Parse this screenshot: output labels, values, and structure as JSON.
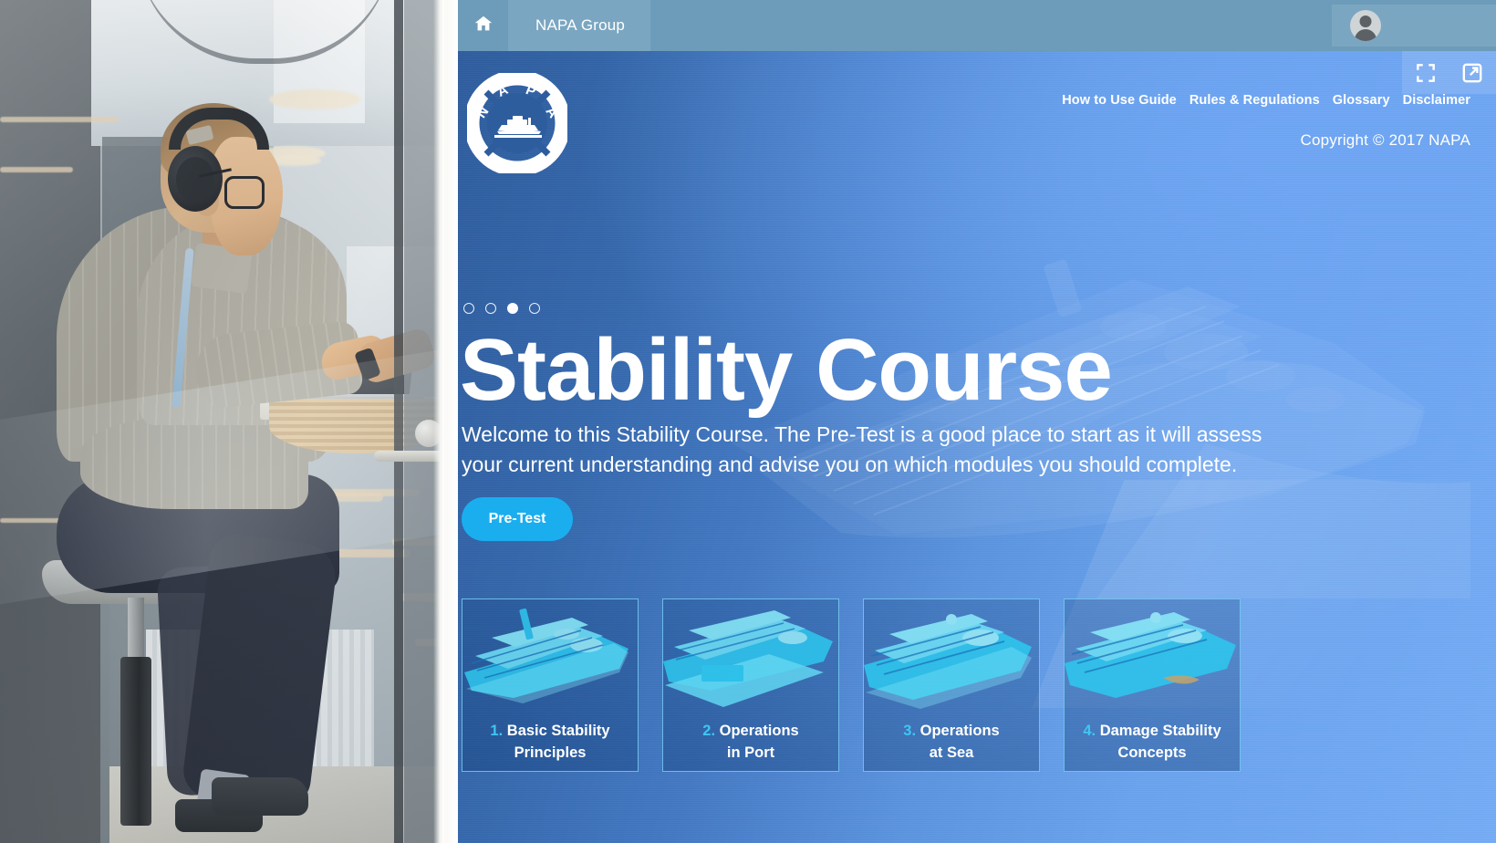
{
  "breadcrumb": {
    "home_icon": "home-icon",
    "items": [
      {
        "label": "NAPA Group"
      }
    ],
    "user": {
      "avatar_icon": "user-avatar-icon"
    }
  },
  "window_controls": {
    "fullscreen_label": "fullscreen-icon",
    "popout_label": "open-in-new-window-icon"
  },
  "brand": {
    "logo_name": "NAPA",
    "logo_letters": "NAPA"
  },
  "top_nav": {
    "links": [
      {
        "label": "How to Use Guide"
      },
      {
        "label": "Rules & Regulations"
      },
      {
        "label": "Glossary"
      },
      {
        "label": "Disclaimer"
      }
    ]
  },
  "copyright": "Copyright © 2017 NAPA",
  "carousel": {
    "total": 4,
    "active_index": 2
  },
  "hero": {
    "title": "Stability Course",
    "description": "Welcome to this Stability Course. The Pre-Test is a good place to start as it will assess your current understanding and advise you on which modules you should complete.",
    "cta_label": "Pre-Test"
  },
  "modules": [
    {
      "number": "1.",
      "line1": "Basic Stability",
      "line2": "Principles"
    },
    {
      "number": "2.",
      "line1": "Operations",
      "line2": "in Port"
    },
    {
      "number": "3.",
      "line1": "Operations",
      "line2": "at Sea"
    },
    {
      "number": "4.",
      "line1": "Damage Stability",
      "line2": "Concepts"
    }
  ],
  "colors": {
    "breadcrumb_bar": "#6d9cba",
    "breadcrumb_active": "#7aa6c1",
    "hero_gradient_start": "#2e5d9e",
    "hero_gradient_end": "#74acf6",
    "accent_cyan": "#1aaeef",
    "card_border": "#78cdf5",
    "card_number": "#3fc6f4",
    "text_white": "#ffffff"
  }
}
